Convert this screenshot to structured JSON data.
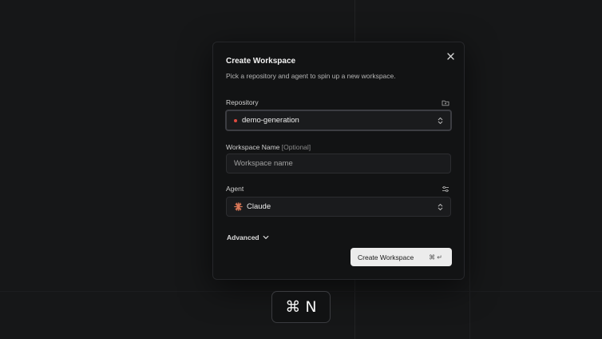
{
  "modal": {
    "title": "Create Workspace",
    "subtitle": "Pick a repository and agent to spin up a new workspace.",
    "close_icon": "close-icon"
  },
  "repository": {
    "label": "Repository",
    "value": "demo-generation",
    "status_color": "#e04a3f",
    "side_icon": "folder-icon"
  },
  "workspace_name": {
    "label": "Workspace Name",
    "optional": "[Optional]",
    "placeholder": "Workspace name",
    "value": ""
  },
  "agent": {
    "label": "Agent",
    "value": "Claude",
    "icon": "claude-icon",
    "icon_color": "#d97757",
    "side_icon": "sliders-icon"
  },
  "advanced": {
    "label": "Advanced"
  },
  "create_button": {
    "label": "Create Workspace",
    "shortcut": "⌘ ↵"
  },
  "shortcut_hint": {
    "keys": "⌘ N"
  }
}
